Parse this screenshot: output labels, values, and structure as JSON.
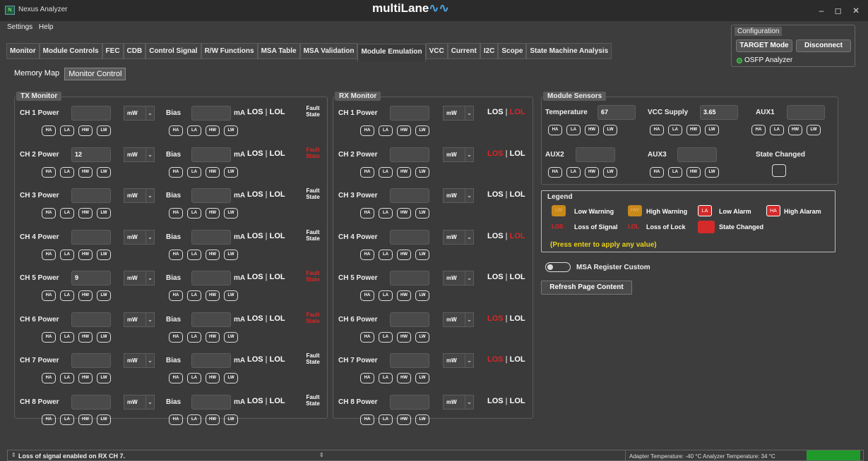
{
  "app": {
    "title": "Nexus Analyzer",
    "logo_text": "multiLane",
    "icon_text": "N",
    "window_buttons": "– ◻ ✕"
  },
  "menu": [
    "Settings",
    "Help"
  ],
  "tabs": [
    "Monitor",
    "Module Controls",
    "FEC",
    "CDB",
    "Control Signal",
    "R/W Functions",
    "MSA Table",
    "MSA Validation",
    "Module Emulation",
    "VCC",
    "Current",
    "I2C",
    "Scope",
    "State Machine Analysis"
  ],
  "active_tab": "Module Emulation",
  "config": {
    "title": "Configuration",
    "target_btn": "TARGET Mode",
    "disconnect_btn": "Disconnect",
    "device": "OSFP Analyzer"
  },
  "subtabs": [
    "Memory Map",
    "Monitor Control"
  ],
  "chips": [
    "HA",
    "LA",
    "HW",
    "LW"
  ],
  "tx": {
    "title": "TX Monitor",
    "power_unit": "mW",
    "bias_label": "Bias",
    "bias_unit": "mA",
    "los": "LOS",
    "lol": "LOL",
    "fault": "Fault State",
    "rows": [
      {
        "label": "CH 1 Power",
        "power": "",
        "fault_red": false
      },
      {
        "label": "CH 2 Power",
        "power": "12",
        "fault_red": true
      },
      {
        "label": "CH 3 Power",
        "power": "",
        "fault_red": false
      },
      {
        "label": "CH 4 Power",
        "power": "",
        "fault_red": false
      },
      {
        "label": "CH 5 Power",
        "power": "9",
        "fault_red": true
      },
      {
        "label": "CH 6 Power",
        "power": "",
        "fault_red": true
      },
      {
        "label": "CH 7 Power",
        "power": "",
        "fault_red": false
      },
      {
        "label": "CH 8 Power",
        "power": "",
        "fault_red": false
      }
    ]
  },
  "rx": {
    "title": "RX Monitor",
    "power_unit": "mW",
    "los": "LOS",
    "lol": "LOL",
    "rows": [
      {
        "label": "CH 1 Power",
        "los_red": false,
        "lol_red": true
      },
      {
        "label": "CH 2 Power",
        "los_red": true,
        "lol_red": false
      },
      {
        "label": "CH 3 Power",
        "los_red": false,
        "lol_red": false
      },
      {
        "label": "CH 4 Power",
        "los_red": false,
        "lol_red": true
      },
      {
        "label": "CH 5 Power",
        "los_red": false,
        "lol_red": false
      },
      {
        "label": "CH 6 Power",
        "los_red": true,
        "lol_red": false
      },
      {
        "label": "CH 7 Power",
        "los_red": true,
        "lol_red": false
      },
      {
        "label": "CH 8 Power",
        "los_red": false,
        "lol_red": false
      }
    ]
  },
  "sensors": {
    "title": "Module Sensors",
    "temperature": {
      "label": "Temperature",
      "value": "67"
    },
    "vcc": {
      "label": "VCC Supply",
      "value": "3.65"
    },
    "aux1": {
      "label": "AUX1",
      "value": ""
    },
    "aux2": {
      "label": "AUX2",
      "value": ""
    },
    "aux3": {
      "label": "AUX3",
      "value": ""
    },
    "state_changed": "State Changed"
  },
  "legend": {
    "title": "Legend",
    "low_warning": "Low Warning",
    "high_warning": "High Warning",
    "low_alarm": "Low Alarm",
    "high_alarm": "High Alaram",
    "los_label": "Loss of Signal",
    "lol_label": "Loss of Lock",
    "state_changed": "State Changed",
    "hint": "(Press enter to apply any value)",
    "sw_lw": "LW",
    "sw_hw": "HW",
    "sw_la": "LA",
    "sw_ha": "HA",
    "sw_los": "LOS",
    "sw_lol": "LOL"
  },
  "msa_toggle": "MSA Register Custom",
  "refresh_btn": "Refresh Page Content",
  "status": {
    "message": "Loss of signal enabled on RX CH 7.",
    "temps": "Adapter Temperature: -40 °C  Analyzer Temperature: 34 °C"
  },
  "colors": {
    "warning": "#c9891a",
    "alarm": "#d42a2a",
    "red_text": "#e12424",
    "status_green": "#1f9a2a"
  }
}
